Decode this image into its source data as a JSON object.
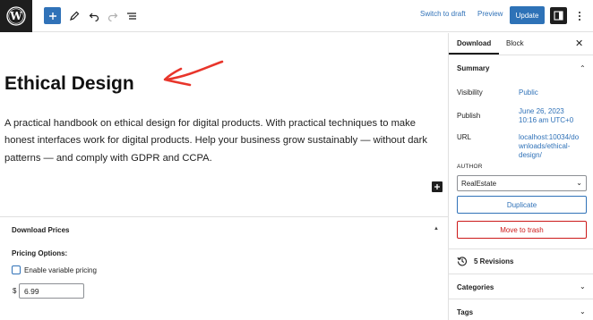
{
  "toolbar": {
    "logo_icon": "wordpress-logo-icon",
    "add_icon": "plus-icon",
    "tools_icon": "pen-icon",
    "undo_icon": "undo-icon",
    "redo_icon": "redo-icon",
    "outline_icon": "list-view-icon",
    "switch_to_draft": "Switch to draft",
    "preview": "Preview",
    "update": "Update",
    "settings_icon": "sidebar-toggle-icon",
    "more_icon": "more-vertical-icon",
    "accent_color": "#3072b8"
  },
  "editor": {
    "title": "Ethical Design",
    "annotation_arrow_color": "#e8352b",
    "paragraph": "A practical handbook on ethical design for digital products. With practical techniques to make honest interfaces work for digital products. Help your business grow sustainably — without dark patterns — and comply with GDPR and CCPA."
  },
  "metabox": {
    "title": "Download Prices",
    "pricing_options_label": "Pricing Options:",
    "variable_pricing_label": "Enable variable pricing",
    "currency_symbol": "$",
    "price_value": "6.99"
  },
  "sidebar": {
    "tabs": [
      {
        "label": "Download",
        "active": true
      },
      {
        "label": "Block",
        "active": false
      }
    ],
    "close_icon": "close-icon",
    "summary": {
      "title": "Summary",
      "rows": [
        {
          "label": "Visibility",
          "value": "Public"
        },
        {
          "label": "Publish",
          "value_lines": [
            "June 26, 2023",
            "10:16 am UTC+0"
          ]
        },
        {
          "label": "URL",
          "value_lines": [
            "localhost:10034/do",
            "wnloads/ethical-",
            "design/"
          ]
        }
      ]
    },
    "author": {
      "label": "AUTHOR",
      "value": "RealEstate"
    },
    "duplicate": "Duplicate",
    "move_to_trash": "Move to trash",
    "revisions": "5 Revisions",
    "panels": [
      {
        "title": "Categories"
      },
      {
        "title": "Tags"
      }
    ],
    "danger_color": "#cc1818"
  }
}
